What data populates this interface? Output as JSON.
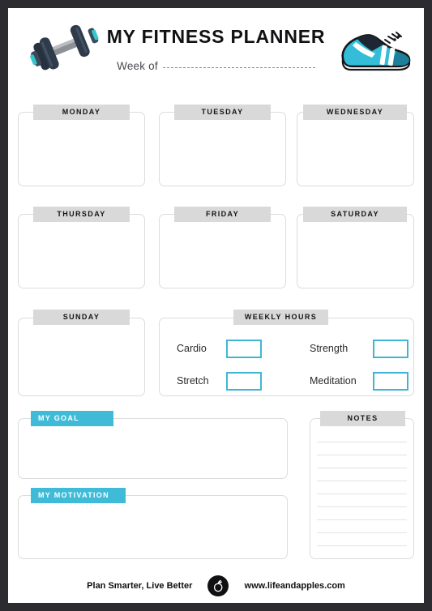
{
  "page": {
    "title": "MY FITNESS PLANNER",
    "frame_color": "#2b2b30",
    "sheet_color": "#ffffff",
    "accent_color": "#3fbbd8",
    "tab_gray": "#d9d9d9"
  },
  "header": {
    "title": "MY FITNESS PLANNER",
    "week_of_label": "Week of",
    "week_of_value": "",
    "left_icon": "dumbbell-icon",
    "right_icon": "running-shoe-icon"
  },
  "days": [
    {
      "label": "MONDAY",
      "value": ""
    },
    {
      "label": "TUESDAY",
      "value": ""
    },
    {
      "label": "WEDNESDAY",
      "value": ""
    },
    {
      "label": "THURSDAY",
      "value": ""
    },
    {
      "label": "FRIDAY",
      "value": ""
    },
    {
      "label": "SATURDAY",
      "value": ""
    },
    {
      "label": "SUNDAY",
      "value": ""
    }
  ],
  "weekly_hours": {
    "label": "WEEKLY HOURS",
    "fields": [
      {
        "label": "Cardio",
        "value": ""
      },
      {
        "label": "Strength",
        "value": ""
      },
      {
        "label": "Stretch",
        "value": ""
      },
      {
        "label": "Meditation",
        "value": ""
      }
    ]
  },
  "goal": {
    "label": "MY GOAL",
    "value": ""
  },
  "motivation": {
    "label": "MY MOTIVATION",
    "value": ""
  },
  "notes": {
    "label": "NOTES",
    "value": "",
    "line_count": 9
  },
  "footer": {
    "tagline": "Plan Smarter, Live Better",
    "url": "www.lifeandapples.com",
    "logo": "apple-logo-icon"
  }
}
